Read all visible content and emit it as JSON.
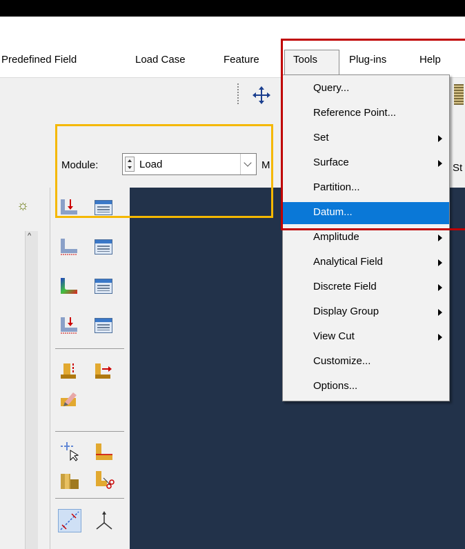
{
  "menubar": {
    "items": [
      "Predefined Field",
      "Load Case",
      "Feature",
      "Tools",
      "Plug-ins",
      "Help"
    ]
  },
  "module": {
    "label": "Module:",
    "value": "Load",
    "cut_label_m": "M",
    "cut_label_st": "St"
  },
  "tools_menu": {
    "items": [
      {
        "label": "Query...",
        "submenu": false
      },
      {
        "label": "Reference Point...",
        "submenu": false
      },
      {
        "label": "Set",
        "submenu": true
      },
      {
        "label": "Surface",
        "submenu": true
      },
      {
        "label": "Partition...",
        "submenu": false
      },
      {
        "label": "Datum...",
        "submenu": false,
        "selected": true
      },
      {
        "label": "Amplitude",
        "submenu": true
      },
      {
        "label": "Analytical Field",
        "submenu": true
      },
      {
        "label": "Discrete Field",
        "submenu": true
      },
      {
        "label": "Display Group",
        "submenu": true
      },
      {
        "label": "View Cut",
        "submenu": true
      },
      {
        "label": "Customize...",
        "submenu": false
      },
      {
        "label": "Options...",
        "submenu": false
      }
    ]
  },
  "colors": {
    "viewport": "#22324a",
    "highlight_yellow": "#f5b800",
    "highlight_red": "#c00000",
    "selected_item": "#0a78d7"
  },
  "icons": {
    "toolbar": [
      "move-cross-icon",
      "toolbar-ruler-icon"
    ],
    "toolbox": [
      "load-create-icon",
      "load-manager-icon",
      "bc-create-icon",
      "bc-manager-icon",
      "field-create-icon",
      "field-manager-icon",
      "step-create-icon",
      "step-manager-icon",
      "load-apply-icon",
      "load-move-icon",
      "load-edit-icon",
      "datum-point-icon",
      "partition-face-icon",
      "partition-cell-icon",
      "partition-cut-icon",
      "datum-axis-icon",
      "csys-icon"
    ],
    "panel": [
      "lightbulb-icon",
      "scroll-up-icon"
    ]
  }
}
